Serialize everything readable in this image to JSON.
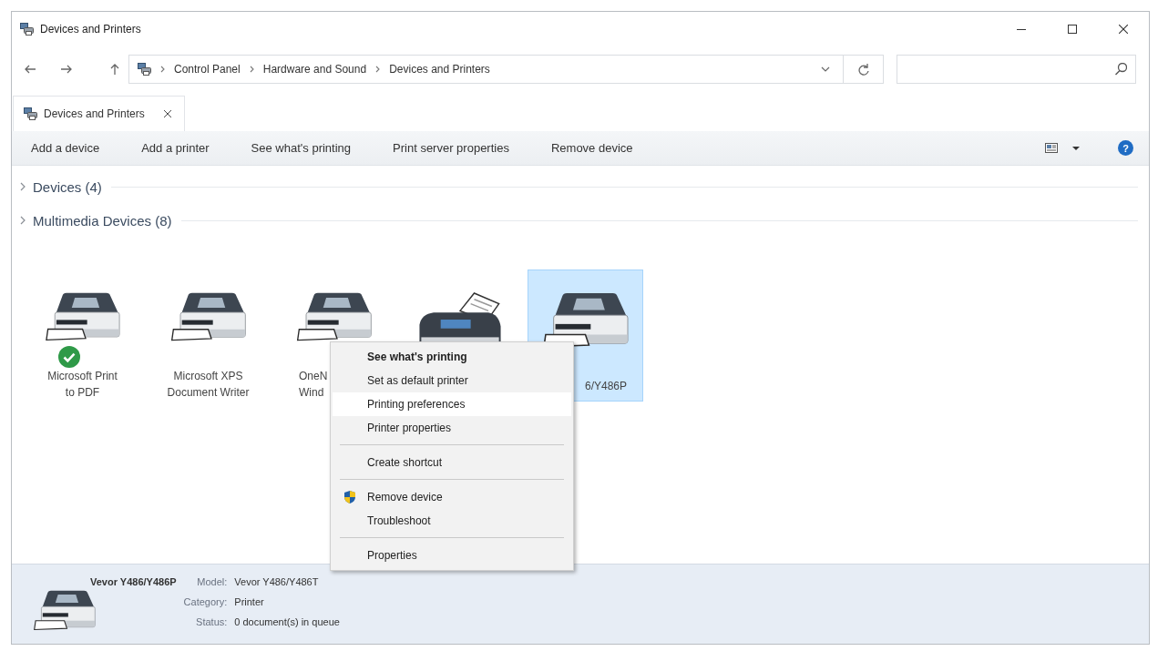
{
  "window": {
    "title": "Devices and Printers"
  },
  "address_bar": {
    "breadcrumbs": [
      "Control Panel",
      "Hardware and Sound",
      "Devices and Printers"
    ]
  },
  "tabs": [
    {
      "label": "Devices and Printers",
      "selected": true
    }
  ],
  "command_bar": {
    "commands": [
      "Add a device",
      "Add a printer",
      "See what's printing",
      "Print server properties",
      "Remove device"
    ],
    "help": "?"
  },
  "groups": [
    {
      "label": "Devices (4)",
      "expanded": false
    },
    {
      "label": "Multimedia Devices (8)",
      "expanded": false
    }
  ],
  "devices": [
    {
      "kind": "printer",
      "lines": [
        "Microsoft Print",
        "to PDF"
      ],
      "default": true,
      "selected": false
    },
    {
      "kind": "printer",
      "lines": [
        "Microsoft XPS",
        "Document Writer"
      ],
      "default": false,
      "selected": false
    },
    {
      "kind": "printer",
      "lines": [
        "OneN",
        "Wind"
      ],
      "default": false,
      "selected": false
    },
    {
      "kind": "fax",
      "default": false,
      "selected": false
    },
    {
      "kind": "printer",
      "lines": [
        "6/Y486P"
      ],
      "default": false,
      "selected": true
    }
  ],
  "context_menu": {
    "sections": [
      [
        {
          "kind": "normal",
          "label": "See what's printing",
          "default": true,
          "selected": false
        },
        {
          "kind": "normal",
          "label": "Set as default printer",
          "default": false,
          "selected": false
        },
        {
          "kind": "normal",
          "label": "Printing preferences",
          "default": false,
          "selected": true
        },
        {
          "kind": "normal",
          "label": "Printer properties",
          "default": false,
          "selected": false
        }
      ],
      [
        {
          "kind": "normal",
          "label": "Create shortcut",
          "default": false,
          "selected": false
        }
      ],
      [
        {
          "kind": "elevated",
          "label": "Remove device",
          "default": false,
          "selected": false
        },
        {
          "kind": "normal",
          "label": "Troubleshoot",
          "default": false,
          "selected": false
        }
      ],
      [
        {
          "kind": "normal",
          "label": "Properties",
          "default": false,
          "selected": false
        }
      ]
    ]
  },
  "details": {
    "name": "Vevor Y486/Y486P",
    "fields": [
      {
        "label": "Model:",
        "value": "Vevor Y486/Y486T"
      },
      {
        "label": "Category:",
        "value": "Printer"
      },
      {
        "label": "Status:",
        "value": "0 document(s) in queue"
      }
    ]
  }
}
